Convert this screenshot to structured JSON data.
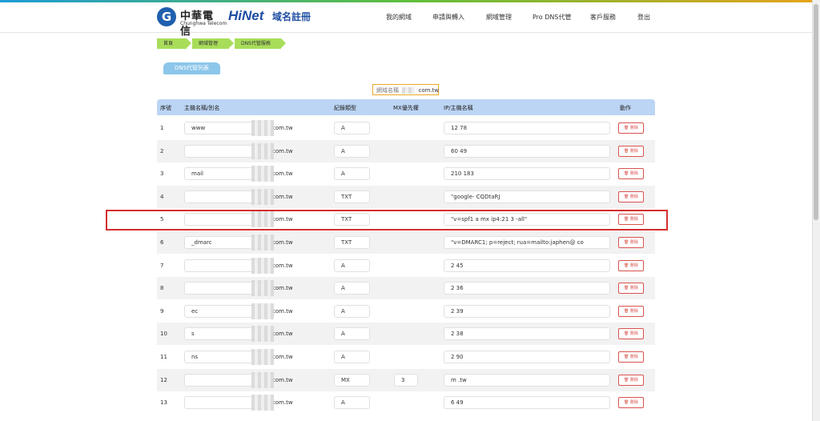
{
  "header": {
    "company_name": "中華電信",
    "company_en": "Chunghwa Telecom",
    "brand": "HiNet",
    "brand_sub": "域名註冊",
    "nav": [
      "我的網域",
      "申請與轉入",
      "網域管理",
      "Pro DNS代管",
      "客戶服務",
      "登出"
    ]
  },
  "breadcrumb": [
    "首頁",
    "網域管理",
    "DNS代管服務"
  ],
  "section_title": "DNS代管列表",
  "domain_label": "網域名稱",
  "domain_suffix": "com.tw",
  "table": {
    "headers": [
      "序號",
      "主機名稱/別名",
      "紀錄類型",
      "MX優先權",
      "IP/主機名稱",
      "動作"
    ],
    "delete_label": "刪除",
    "rows": [
      {
        "no": "1",
        "host": "www",
        "suffix": "com.tw",
        "type": "A",
        "mx": "",
        "ip": "12          78"
      },
      {
        "no": "2",
        "host": "",
        "suffix": "com.tw",
        "type": "A",
        "mx": "",
        "ip": "60            49"
      },
      {
        "no": "3",
        "host": "mail",
        "suffix": "com.tw",
        "type": "A",
        "mx": "",
        "ip": "210          183"
      },
      {
        "no": "4",
        "host": "",
        "suffix": "com.tw",
        "type": "TXT",
        "mx": "",
        "ip": "\"google-                                    CQDtaRJ"
      },
      {
        "no": "5",
        "host": "",
        "suffix": "com.tw",
        "type": "TXT",
        "mx": "",
        "ip": "\"v=spf1 a mx ip4:21                3 -all\""
      },
      {
        "no": "6",
        "host": "_dmarc",
        "suffix": "com.tw",
        "type": "TXT",
        "mx": "",
        "ip": "\"v=DMARC1; p=reject; rua=mailto:japhen@        co"
      },
      {
        "no": "7",
        "host": "",
        "suffix": "com.tw",
        "type": "A",
        "mx": "",
        "ip": "2              45"
      },
      {
        "no": "8",
        "host": "",
        "suffix": "com.tw",
        "type": "A",
        "mx": "",
        "ip": "2              36"
      },
      {
        "no": "9",
        "host": "ec",
        "suffix": "com.tw",
        "type": "A",
        "mx": "",
        "ip": "2              39"
      },
      {
        "no": "10",
        "host": "s",
        "suffix": "com.tw",
        "type": "A",
        "mx": "",
        "ip": "2              38"
      },
      {
        "no": "11",
        "host": "ns",
        "suffix": "com.tw",
        "type": "A",
        "mx": "",
        "ip": "2              90"
      },
      {
        "no": "12",
        "host": "",
        "suffix": "com.tw",
        "type": "MX",
        "mx": "3",
        "ip": "m              .tw"
      },
      {
        "no": "13",
        "host": "",
        "suffix": "com.tw",
        "type": "A",
        "mx": "",
        "ip": "6              49"
      }
    ]
  }
}
